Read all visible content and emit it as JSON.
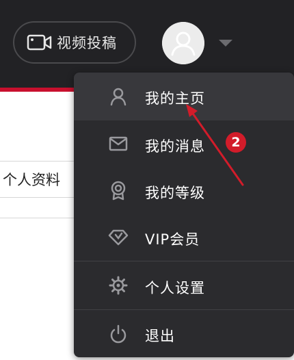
{
  "header": {
    "video_upload_label": "视频投稿",
    "video_icon": "video-camera-icon",
    "avatar_icon": "user-avatar-icon",
    "caret_icon": "caret-down-icon"
  },
  "page": {
    "tab_label": "个人资料"
  },
  "menu": {
    "items": [
      {
        "label": "我的主页",
        "icon": "user-icon"
      },
      {
        "label": "我的消息",
        "icon": "envelope-icon"
      },
      {
        "label": "我的等级",
        "icon": "medal-icon"
      },
      {
        "label": "VIP会员",
        "icon": "diamond-icon"
      },
      {
        "label": "个人设置",
        "icon": "gear-icon"
      },
      {
        "label": "退出",
        "icon": "power-icon"
      }
    ]
  },
  "annotation": {
    "badge_number": "2",
    "color": "#d21c2a"
  },
  "colors": {
    "header_bg": "#222225",
    "accent_red": "#c8102e",
    "menu_bg": "#2b2b2e",
    "menu_active_bg": "#38383c"
  }
}
